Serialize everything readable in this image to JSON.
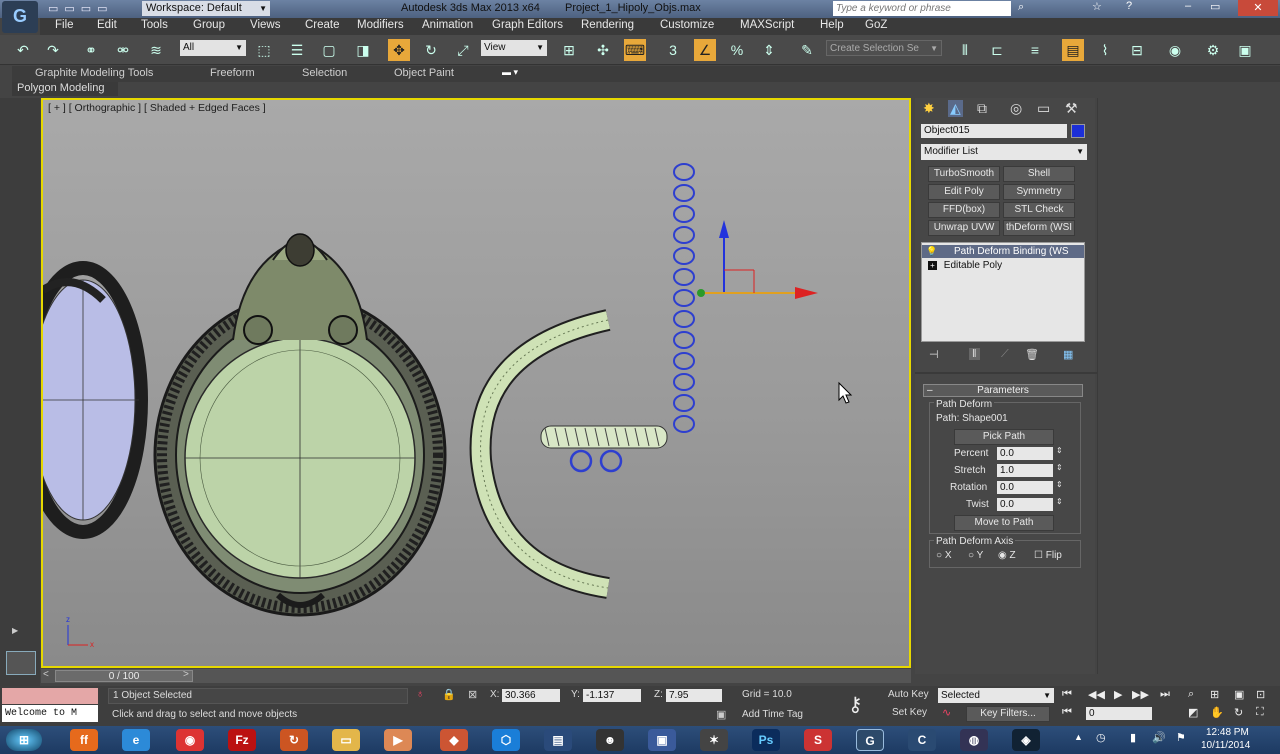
{
  "title_bar": {
    "workspace": "Workspace: Default",
    "app_title": "Autodesk 3ds Max  2013 x64",
    "file_title": "Project_1_Hipoly_Objs.max",
    "search_placeholder": "Type a keyword or phrase"
  },
  "menu": [
    "File",
    "Edit",
    "Tools",
    "Group",
    "Views",
    "Create",
    "Modifiers",
    "Animation",
    "Graph Editors",
    "Rendering",
    "Customize",
    "MAXScript",
    "Help",
    "GoZ"
  ],
  "toolbar": {
    "selection_filter": "All",
    "reference_coord": "View",
    "named_selection_placeholder": "Create Selection Se"
  },
  "ribbon": {
    "tabs": [
      "Graphite Modeling Tools",
      "Freeform",
      "Selection",
      "Object Paint"
    ],
    "sub_tab": "Polygon Modeling"
  },
  "viewport": {
    "label": "[ + ] [ Orthographic ] [ Shaded + Edged Faces ]",
    "axis_z": "z",
    "axis_x": "x"
  },
  "command_panel": {
    "object_name": "Object015",
    "object_color": "#1c2fd8",
    "modifier_list": "Modifier List",
    "modifier_buttons": [
      "TurboSmooth",
      "Shell",
      "Edit Poly",
      "Symmetry",
      "FFD(box)",
      "STL Check",
      "Unwrap UVW",
      "thDeform (WSI"
    ],
    "stack": [
      "Path Deform Binding (WS",
      "Editable Poly"
    ],
    "parameters": {
      "rollout_title": "Parameters",
      "group_title": "Path Deform",
      "path_label": "Path: Shape001",
      "pick_path": "Pick Path",
      "percent_label": "Percent",
      "percent": "0.0",
      "stretch_label": "Stretch",
      "stretch": "1.0",
      "rotation_label": "Rotation",
      "rotation": "0.0",
      "twist_label": "Twist",
      "twist": "0.0",
      "move_to_path": "Move to Path",
      "axis_group": "Path Deform Axis",
      "axis_x": "X",
      "axis_y": "Y",
      "axis_z": "Z",
      "flip": "Flip"
    }
  },
  "timeline": {
    "frame": "0 / 100"
  },
  "status": {
    "maxscript": "Welcome to M",
    "selected": "1 Object Selected",
    "prompt": "Click and drag to select and move objects",
    "x_label": "X:",
    "x": "30.366",
    "y_label": "Y:",
    "y": "-1.137",
    "z_label": "Z:",
    "z": "7.95",
    "grid": "Grid = 10.0",
    "add_time_tag": "Add Time Tag",
    "auto_key": "Auto Key",
    "set_key": "Set Key",
    "key_mode": "Selected",
    "key_filters": "Key Filters...",
    "current_frame": "0"
  },
  "clock": {
    "time": "12:48 PM",
    "date": "10/11/2014"
  }
}
